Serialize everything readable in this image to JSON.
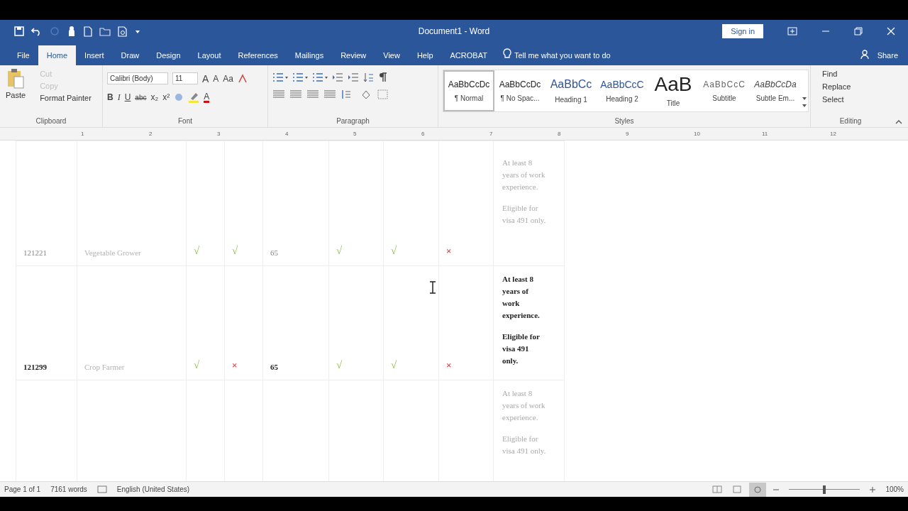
{
  "title_bar": {
    "title": "Document1 - Word",
    "sign_in": "Sign in"
  },
  "tabs": [
    {
      "label": "File",
      "selected": false
    },
    {
      "label": "Home",
      "selected": true
    },
    {
      "label": "Insert",
      "selected": false
    },
    {
      "label": "Draw",
      "selected": false
    },
    {
      "label": "Design",
      "selected": false
    },
    {
      "label": "Layout",
      "selected": false
    },
    {
      "label": "References",
      "selected": false
    },
    {
      "label": "Mailings",
      "selected": false
    },
    {
      "label": "Review",
      "selected": false
    },
    {
      "label": "View",
      "selected": false
    },
    {
      "label": "Help",
      "selected": false
    },
    {
      "label": "ACROBAT",
      "selected": false
    }
  ],
  "tell_me": "Tell me what you want to do",
  "share": "Share",
  "clipboard": {
    "paste": "Paste",
    "label": "Clipboard",
    "items": [
      {
        "label": "Cut",
        "disabled": true
      },
      {
        "label": "Copy",
        "disabled": true
      },
      {
        "label": "Format Painter",
        "disabled": false
      }
    ]
  },
  "font": {
    "name": "Calibri (Body)",
    "size": "11",
    "grow_shrink": [
      "A",
      "A"
    ],
    "case_button": "Aa",
    "format_buttons": [
      "B",
      "I",
      "U",
      "abc",
      "x₂",
      "x²"
    ],
    "font_color": "A",
    "label": "Font"
  },
  "paragraph": {
    "label": "Paragraph"
  },
  "styles": {
    "label": "Styles",
    "items": [
      {
        "preview": "AaBbCcDc",
        "name": "¶ Normal",
        "selected": true,
        "kind": "normal"
      },
      {
        "preview": "AaBbCcDc",
        "name": "¶ No Spac...",
        "selected": false,
        "kind": "normal"
      },
      {
        "preview": "AaBbCc",
        "name": "Heading 1",
        "selected": false,
        "kind": "heading1"
      },
      {
        "preview": "AaBbCcC",
        "name": "Heading 2",
        "selected": false,
        "kind": "heading2"
      },
      {
        "preview": "AaB",
        "name": "Title",
        "selected": false,
        "kind": "title"
      },
      {
        "preview": "AaBbCcC",
        "name": "Subtitle",
        "selected": false,
        "kind": "subtitle"
      },
      {
        "preview": "AaBbCcDa",
        "name": "Subtle Em...",
        "selected": false,
        "kind": "emphasis"
      }
    ]
  },
  "editing": {
    "label": "Editing",
    "items": [
      "Find",
      "Replace",
      "Select"
    ]
  },
  "ruler": [
    "1",
    "2",
    "3",
    "4",
    "5",
    "6",
    "7",
    "8",
    "9",
    "10",
    "11",
    "12"
  ],
  "table": {
    "rows": [
      {
        "active": false,
        "code": "121221",
        "name": "Vegetable Grower",
        "marks": [
          {
            "kind": "check",
            "text": "√"
          },
          {
            "kind": "check",
            "text": "√"
          },
          {
            "kind": "text",
            "text": "65"
          },
          {
            "kind": "check",
            "text": "√"
          },
          {
            "kind": "check",
            "text": "√"
          },
          {
            "kind": "cross",
            "text": "×"
          }
        ],
        "notes": [
          "At least 8 years of work experience.",
          "Eligible for visa 491 only."
        ]
      },
      {
        "active": true,
        "code": "121299",
        "name": "Crop Farmer",
        "marks": [
          {
            "kind": "check",
            "text": "√"
          },
          {
            "kind": "cross",
            "text": "×"
          },
          {
            "kind": "text",
            "text": "65"
          },
          {
            "kind": "check",
            "text": "√"
          },
          {
            "kind": "check",
            "text": "√"
          },
          {
            "kind": "cross",
            "text": "×"
          }
        ],
        "notes": [
          "At least 8 years of work experience.",
          "Eligible for visa 491 only."
        ]
      },
      {
        "active": false,
        "notes": [
          "At least 8 years of work experience.",
          "Eligible for visa 491 only."
        ]
      }
    ]
  },
  "status_bar": {
    "page": "Page 1 of 1",
    "words": "7161 words",
    "language": "English (United States)",
    "zoom": "100%",
    "zoom_slider": {
      "level": 0.5
    }
  }
}
